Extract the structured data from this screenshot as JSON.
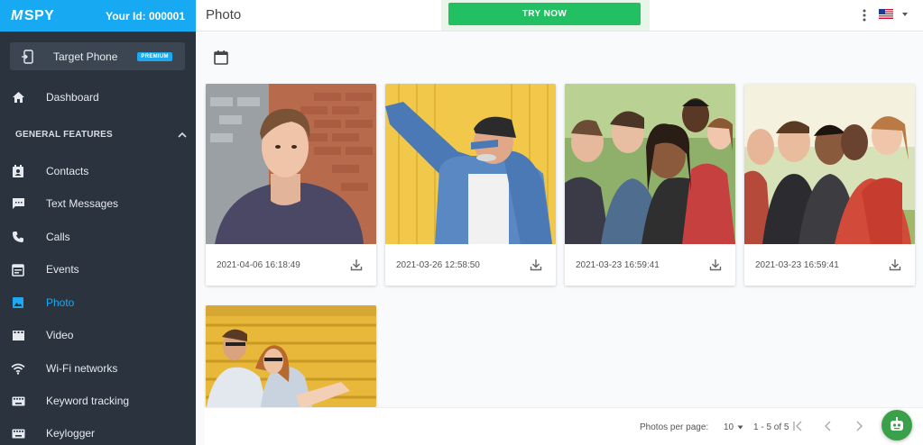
{
  "brand": {
    "logo_m": "M",
    "logo_text": "SPY"
  },
  "header": {
    "user_id": "Your Id: 000001"
  },
  "target_phone": {
    "label": "Target Phone",
    "badge": "PREMIUM"
  },
  "sidebar": {
    "dashboard": "Dashboard",
    "section_title": "GENERAL FEATURES",
    "items": [
      {
        "label": "Contacts",
        "icon": "contacts-icon"
      },
      {
        "label": "Text Messages",
        "icon": "message-icon"
      },
      {
        "label": "Calls",
        "icon": "phone-icon"
      },
      {
        "label": "Events",
        "icon": "calendar-icon"
      },
      {
        "label": "Photo",
        "icon": "image-icon",
        "active": true
      },
      {
        "label": "Video",
        "icon": "video-icon"
      },
      {
        "label": "Wi-Fi networks",
        "icon": "wifi-icon"
      },
      {
        "label": "Keyword tracking",
        "icon": "keyboard-icon"
      },
      {
        "label": "Keylogger",
        "icon": "keyboard-icon"
      }
    ]
  },
  "topbar": {
    "title": "Photo",
    "try_now": "TRY NOW"
  },
  "photos": [
    {
      "date": "2021-04-06 16:18:49"
    },
    {
      "date": "2021-03-26 12:58:50"
    },
    {
      "date": "2021-03-23 16:59:41"
    },
    {
      "date": "2021-03-23 16:59:41"
    }
  ],
  "pagination": {
    "per_page_label": "Photos per page:",
    "per_page_value": "10",
    "range": "1 - 5 of 5"
  },
  "colors": {
    "accent": "#17a9f2",
    "sidebar_bg": "#2a333e",
    "try_now": "#23c063",
    "active": "#1fa9f2"
  }
}
